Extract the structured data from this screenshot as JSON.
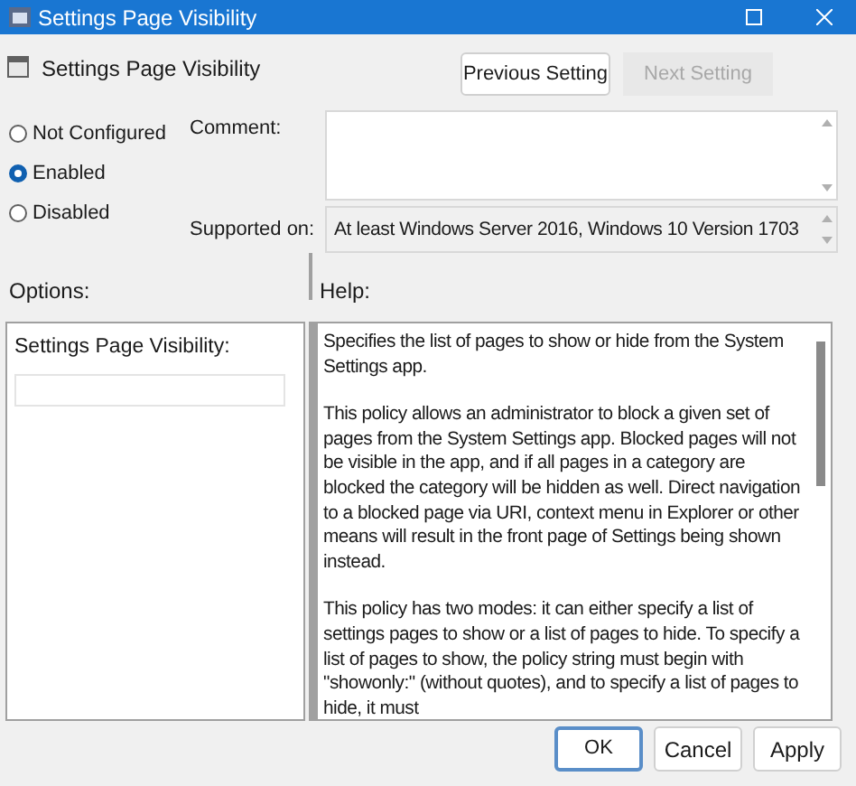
{
  "window": {
    "title": "Settings Page Visibility"
  },
  "header": {
    "title": "Settings Page Visibility"
  },
  "nav_buttons": [
    {
      "label": "Previous Setting",
      "disabled": false
    },
    {
      "label": "Next Setting",
      "disabled": true
    }
  ],
  "state_options": [
    {
      "label": "Not Configured",
      "selected": false
    },
    {
      "label": "Enabled",
      "selected": true
    },
    {
      "label": "Disabled",
      "selected": false
    }
  ],
  "comment": {
    "label": "Comment:"
  },
  "supported_on": {
    "label": "Supported on:",
    "value": "At least Windows Server 2016, Windows 10 Version 1703"
  },
  "options": {
    "label": "Options:",
    "field_label": "Settings Page Visibility:"
  },
  "help": {
    "label": "Help:",
    "paragraphs": [
      "Specifies the list of pages to show or hide from the System Settings app.",
      "This policy allows an administrator to block a given set of pages from the System Settings app. Blocked pages will not be visible in the app, and if all pages in a category are blocked the category will be hidden as well. Direct navigation to a blocked page via URI, context menu in Explorer or other means will result in the front page of Settings being shown instead.",
      "This policy has two modes: it can either specify a list of settings pages to show or a list of pages to hide. To specify a list of pages to show, the policy string must begin with \"showonly:\" (without quotes), and to specify a list of pages to hide, it must"
    ]
  },
  "buttons": [
    {
      "label": "OK",
      "default": true
    },
    {
      "label": "Cancel",
      "default": false
    },
    {
      "label": "Apply",
      "default": false
    }
  ]
}
